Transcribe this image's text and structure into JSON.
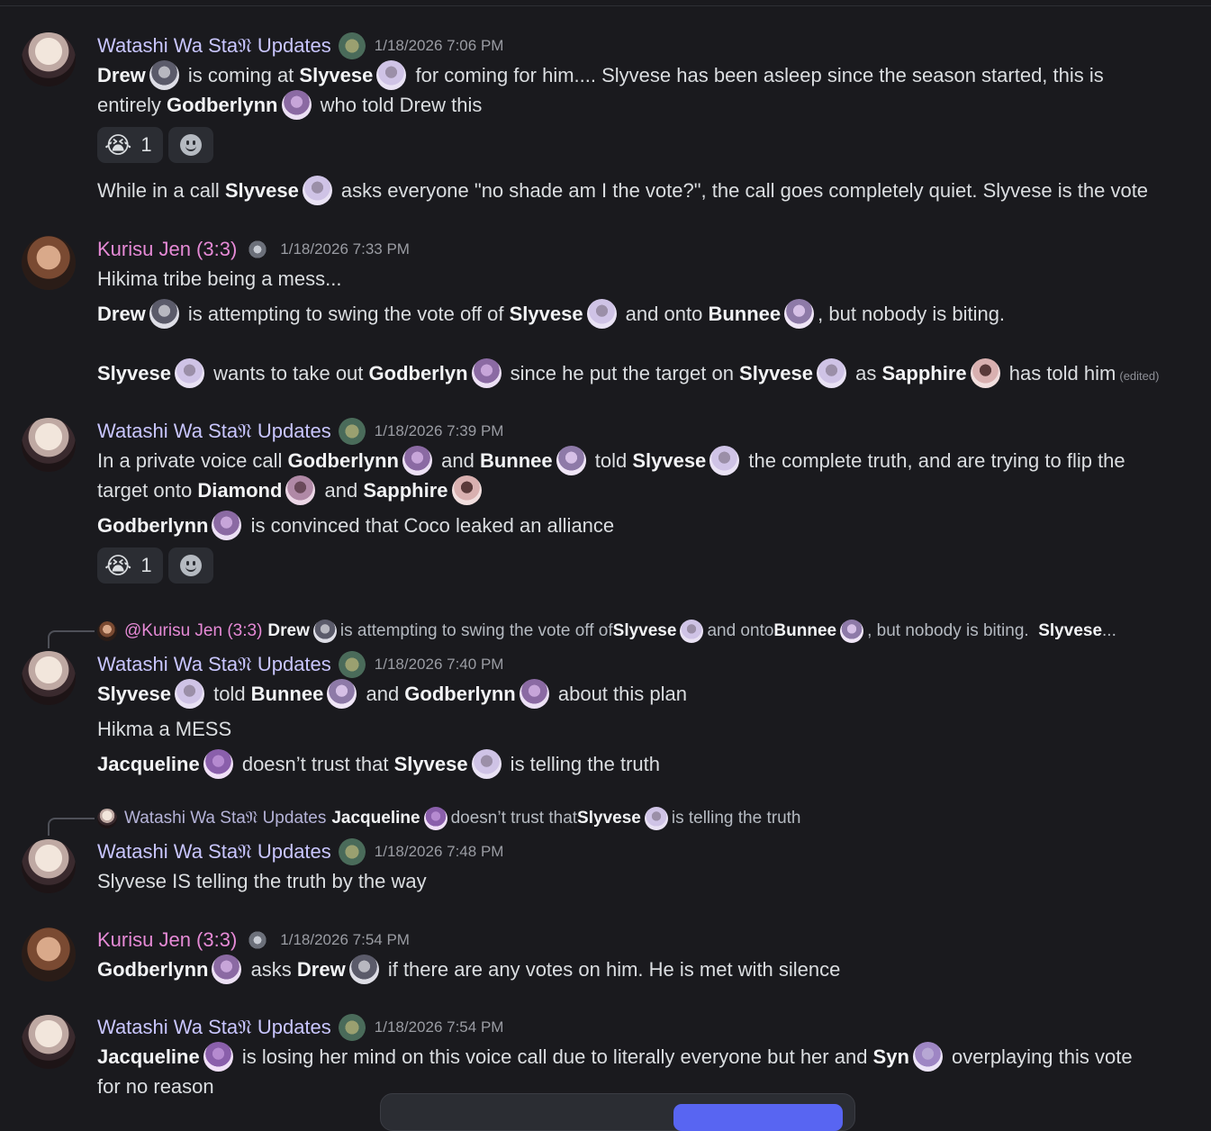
{
  "channel": {
    "messages": [
      {
        "author": "Watashi Wa Sta𝔑 Updates",
        "time": "1/18/2026 7:06 PM",
        "lines": [
          {
            "p": [
              "Drew",
              " is coming at ",
              "Slyvese",
              " for coming for him.... Slyvese has been asleep since the season started, this is"
            ]
          },
          {
            "p": [
              "entirely ",
              "Godberlynn",
              " who told Drew this"
            ]
          }
        ],
        "reaction_count": "1",
        "after": [
          "While in a call ",
          "Slyvese",
          " asks everyone \"no shade am I the vote?\", the call goes completely quiet. Slyvese is the vote"
        ]
      },
      {
        "author": "Kurisu Jen (3:3)",
        "time": "1/18/2026 7:33 PM",
        "l1": "Hikima tribe being a mess...",
        "l2": [
          "Drew",
          " is attempting to swing the vote off of ",
          "Slyvese",
          " and onto ",
          "Bunnee",
          ", but nobody is biting."
        ],
        "l3": [
          "Slyvese",
          " wants to take out ",
          "Godberlyn",
          " since he put the target on ",
          "Slyvese",
          " as ",
          "Sapphire",
          " has told him"
        ],
        "edited": "(edited)"
      },
      {
        "author": "Watashi Wa Sta𝔑 Updates",
        "time": "1/18/2026 7:39 PM",
        "l1": [
          "In a private voice call ",
          "Godberlynn",
          " and ",
          "Bunnee",
          " told ",
          "Slyvese",
          " the complete truth, and are trying to flip the"
        ],
        "l2": [
          "target onto ",
          "Diamond",
          " and ",
          "Sapphire"
        ],
        "l3": [
          "Godberlynn",
          " is convinced that Coco leaked an alliance"
        ],
        "reaction_count": "1"
      },
      {
        "reply": {
          "author": "@Kurisu Jen (3:3)",
          "p": [
            "Drew",
            " is attempting to swing the vote off of ",
            "Slyvese",
            " and onto ",
            "Bunnee",
            ", but nobody is biting.  ",
            "Slyvese",
            " ..."
          ]
        },
        "author": "Watashi Wa Sta𝔑 Updates",
        "time": "1/18/2026 7:40 PM",
        "l1": [
          "Slyvese",
          " told ",
          "Bunnee",
          " and ",
          "Godberlynn",
          " about this plan"
        ],
        "l2": "Hikma a MESS",
        "l3": [
          "Jacqueline",
          " doesn’t trust that ",
          "Slyvese",
          " is telling the truth"
        ]
      },
      {
        "reply": {
          "author": "Watashi Wa Sta𝔑 Updates",
          "p": [
            "Jacqueline",
            " doesn’t trust that ",
            "Slyvese",
            " is telling the truth"
          ]
        },
        "author": "Watashi Wa Sta𝔑 Updates",
        "time": "1/18/2026 7:48 PM",
        "l1": "Slyvese IS telling the truth by the way"
      },
      {
        "author": "Kurisu Jen (3:3)",
        "time": "1/18/2026 7:54 PM",
        "l1": [
          "Godberlynn",
          " asks ",
          "Drew",
          " if there are any votes on him. He is met with silence"
        ]
      },
      {
        "author": "Watashi Wa Sta𝔑 Updates",
        "time": "1/18/2026 7:54 PM",
        "l1": [
          "Jacqueline",
          " is losing her mind on this voice call due to literally everyone but her and ",
          "Syn",
          " overplaying this vote"
        ],
        "l2": "for no reason"
      }
    ]
  },
  "icons": {
    "reaction_emoji": "crying-face-icon",
    "add_reaction": "add-reaction-icon"
  },
  "colors": {
    "background": "#1a1a1e",
    "wata_name": "#c9c6ff",
    "kuri_name": "#e68ad6",
    "timestamp": "#9a9ca3",
    "brand": "#5865f2"
  }
}
